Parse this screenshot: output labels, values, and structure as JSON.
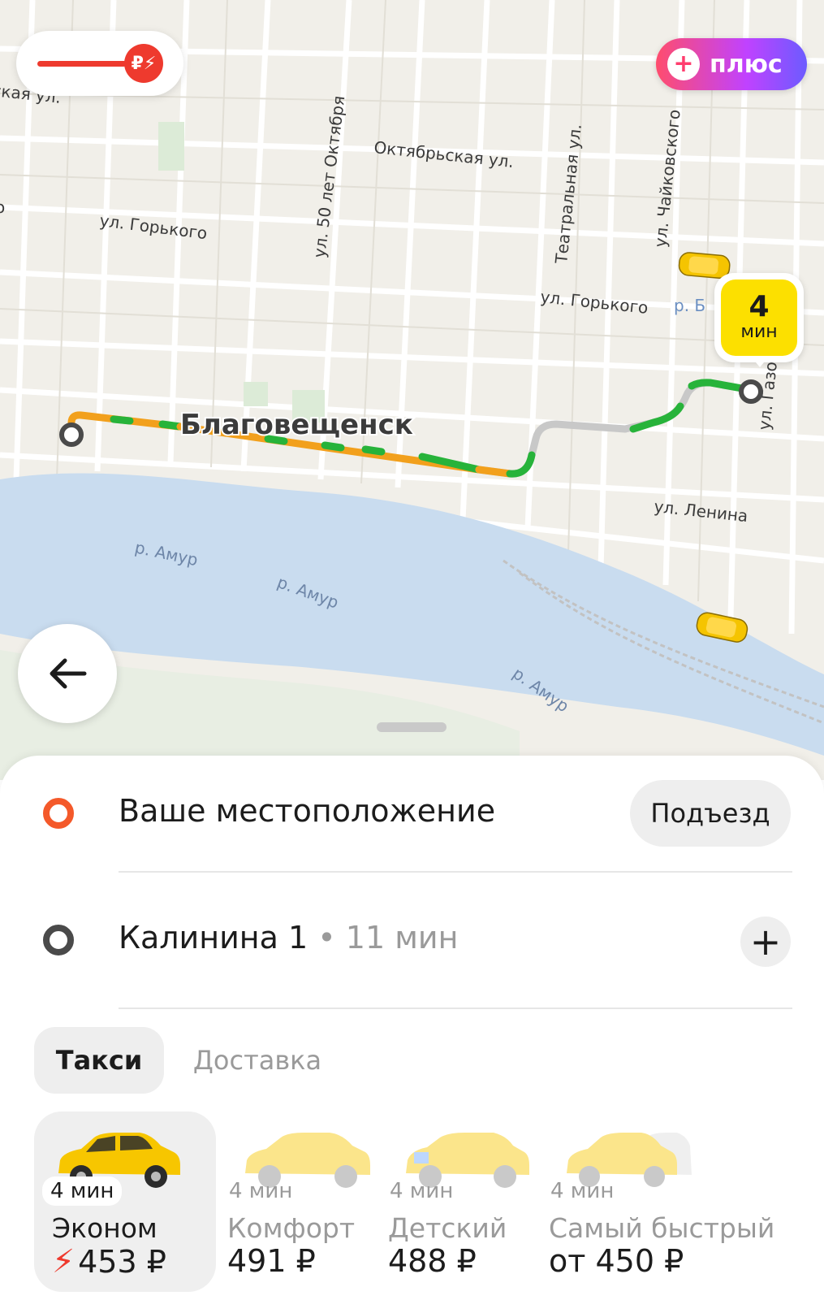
{
  "map": {
    "city_label": "Благовещенск",
    "street_labels": [
      "ская ул.",
      "ул. 50 лет Октября",
      "Октябрьская ул.",
      "ул. Горького",
      "Театральная ул.",
      "ул. Чайковского",
      "ул. Горького",
      "р. Б",
      "ул. Газо",
      "ул. Ленина",
      "р. Амур",
      "р. Амур",
      "р. Амур",
      "о"
    ],
    "colors": {
      "route_fast": "#27b33a",
      "route_slow": "#f2a01c",
      "route_unknown": "#c8c8c8",
      "water": "#c9dcef",
      "land": "#f1efe9"
    }
  },
  "surge": {
    "icon": "ruble-bolt-icon",
    "symbol": "₽⚡",
    "color": "#ee3a2e"
  },
  "plus_badge": {
    "label": "плюс",
    "icon": "plus-icon"
  },
  "eta_bubble": {
    "value": "4",
    "unit": "мин"
  },
  "back_button": {
    "icon": "arrow-left-icon"
  },
  "route": {
    "from": {
      "label": "Ваше местоположение",
      "entrance_button": "Подъезд"
    },
    "to": {
      "label": "Калинина 1",
      "separator": "•",
      "duration": "11 мин",
      "add_button": "+"
    }
  },
  "tabs": [
    {
      "label": "Такси",
      "active": true
    },
    {
      "label": "Доставка",
      "active": false
    }
  ],
  "tariffs": [
    {
      "eta": "4 мин",
      "name": "Эконом",
      "price": "453 ₽",
      "surge": true,
      "selected": true
    },
    {
      "eta": "4 мин",
      "name": "Комфорт",
      "price": "491 ₽",
      "surge": false,
      "selected": false
    },
    {
      "eta": "4 мин",
      "name": "Детский",
      "price": "488 ₽",
      "surge": false,
      "selected": false
    },
    {
      "eta": "4 мин",
      "name": "Самый быстрый",
      "price": "от 450 ₽",
      "surge": false,
      "selected": false
    }
  ]
}
